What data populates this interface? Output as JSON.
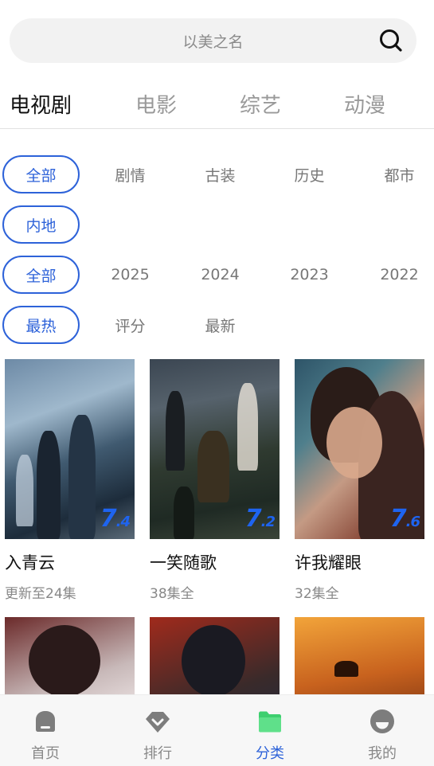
{
  "search": {
    "placeholder": "以美之名"
  },
  "main_tabs": [
    {
      "label": "电视剧",
      "active": true
    },
    {
      "label": "电影",
      "active": false
    },
    {
      "label": "综艺",
      "active": false
    },
    {
      "label": "动漫",
      "active": false
    }
  ],
  "filters": {
    "genre": [
      "全部",
      "剧情",
      "古装",
      "历史",
      "都市"
    ],
    "region": [
      "内地"
    ],
    "year": [
      "全部",
      "2025",
      "2024",
      "2023",
      "2022"
    ],
    "sort": [
      "最热",
      "评分",
      "最新"
    ]
  },
  "shows": [
    {
      "title": "入青云",
      "status": "更新至24集",
      "score_int": "7",
      "score_dec": ".4"
    },
    {
      "title": "一笑随歌",
      "status": "38集全",
      "score_int": "7",
      "score_dec": ".2"
    },
    {
      "title": "许我耀眼",
      "status": "32集全",
      "score_int": "7",
      "score_dec": ".6"
    }
  ],
  "bottom_nav": [
    {
      "label": "首页",
      "icon": "home-icon",
      "active": false
    },
    {
      "label": "排行",
      "icon": "ranking-icon",
      "active": false
    },
    {
      "label": "分类",
      "icon": "folder-icon",
      "active": true
    },
    {
      "label": "我的",
      "icon": "profile-icon",
      "active": false
    }
  ],
  "colors": {
    "accent": "#2d62d9",
    "score": "#1e64f0",
    "active_nav_icon": "#3ecf6f"
  }
}
